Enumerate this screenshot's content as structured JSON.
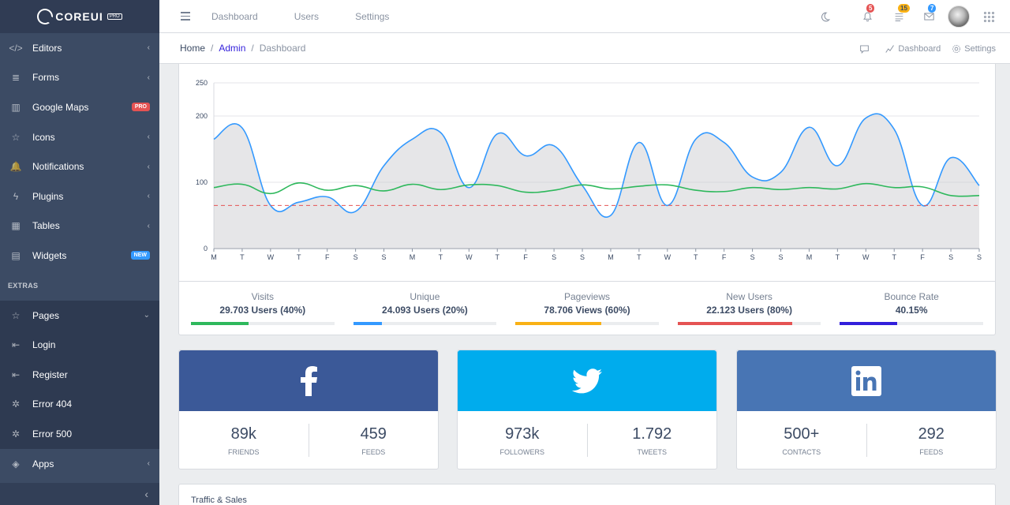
{
  "sidebar": {
    "brand": {
      "name": "COREUI",
      "tag": "PRO"
    },
    "items": [
      {
        "label": "Editors",
        "icon": "code-icon",
        "glyph": "</>",
        "chevron": "‹"
      },
      {
        "label": "Forms",
        "icon": "notes-icon",
        "glyph": "≣",
        "chevron": "‹"
      },
      {
        "label": "Google Maps",
        "icon": "map-icon",
        "glyph": "▥",
        "badge": "PRO",
        "badge_color": "#e55353"
      },
      {
        "label": "Icons",
        "icon": "star-icon",
        "glyph": "☆",
        "chevron": "‹"
      },
      {
        "label": "Notifications",
        "icon": "bell-icon",
        "glyph": "🔔",
        "chevron": "‹"
      },
      {
        "label": "Plugins",
        "icon": "bolt-icon",
        "glyph": "ϟ",
        "chevron": "‹"
      },
      {
        "label": "Tables",
        "icon": "table-icon",
        "glyph": "▦",
        "chevron": "‹"
      },
      {
        "label": "Widgets",
        "icon": "calculator-icon",
        "glyph": "▤",
        "badge": "NEW",
        "badge_color": "#3399ff"
      }
    ],
    "extras_title": "EXTRAS",
    "extras": [
      {
        "label": "Pages",
        "icon": "star-icon",
        "glyph": "☆",
        "chevron": "⌄"
      },
      {
        "label": "Login",
        "icon": "account-login-icon",
        "glyph": "⇤"
      },
      {
        "label": "Register",
        "icon": "account-logout-icon",
        "glyph": "⇤"
      },
      {
        "label": "Error 404",
        "icon": "bug-icon",
        "glyph": "✲"
      },
      {
        "label": "Error 500",
        "icon": "bug-icon",
        "glyph": "✲"
      },
      {
        "label": "Apps",
        "icon": "layers-icon",
        "glyph": "◈",
        "chevron": "‹"
      }
    ],
    "minimize_glyph": "‹"
  },
  "header": {
    "nav": [
      "Dashboard",
      "Users",
      "Settings"
    ],
    "notifications": {
      "count": "5",
      "color": "#e55353"
    },
    "tasks": {
      "count": "15",
      "color": "#f9b115"
    },
    "messages": {
      "count": "7",
      "color": "#3399ff"
    }
  },
  "breadcrumb": {
    "home": "Home",
    "admin": "Admin",
    "current": "Dashboard",
    "sep": "/"
  },
  "subheader_actions": {
    "dashboard": "Dashboard",
    "settings": "Settings"
  },
  "chart_data": {
    "type": "line",
    "x": [
      "M",
      "T",
      "W",
      "T",
      "F",
      "S",
      "S",
      "M",
      "T",
      "W",
      "T",
      "F",
      "S",
      "S",
      "M",
      "T",
      "W",
      "T",
      "F",
      "S",
      "S",
      "M",
      "T",
      "W",
      "T",
      "F",
      "S",
      "S"
    ],
    "ylim": [
      0,
      250
    ],
    "yticks": [
      "0",
      "100",
      "200",
      "250"
    ],
    "series": [
      {
        "values": [
          165,
          182,
          65,
          70,
          78,
          56,
          125,
          165,
          175,
          92,
          173,
          140,
          155,
          95,
          50,
          160,
          65,
          165,
          160,
          108,
          115,
          183,
          125,
          197,
          180,
          65,
          137,
          95
        ],
        "color": "#39f",
        "fill": "rgba(200,200,205,0.45)"
      },
      {
        "values": [
          92,
          97,
          83,
          99,
          88,
          95,
          87,
          97,
          89,
          96,
          95,
          85,
          88,
          96,
          90,
          94,
          96,
          88,
          86,
          92,
          89,
          92,
          90,
          98,
          92,
          93,
          80,
          80
        ],
        "color": "#2eb85c"
      },
      {
        "values": [
          65,
          65,
          65,
          65,
          65,
          65,
          65,
          65,
          65,
          65,
          65,
          65,
          65,
          65,
          65,
          65,
          65,
          65,
          65,
          65,
          65,
          65,
          65,
          65,
          65,
          65,
          65,
          65
        ],
        "color": "#e55353",
        "dashed": true
      }
    ]
  },
  "metrics": [
    {
      "label": "Visits",
      "value": "29.703 Users (40%)",
      "percent": 40,
      "color": "#2eb85c"
    },
    {
      "label": "Unique",
      "value": "24.093 Users (20%)",
      "percent": 20,
      "color": "#39f"
    },
    {
      "label": "Pageviews",
      "value": "78.706 Views (60%)",
      "percent": 60,
      "color": "#f9b115"
    },
    {
      "label": "New Users",
      "value": "22.123 Users (80%)",
      "percent": 80,
      "color": "#e55353"
    },
    {
      "label": "Bounce Rate",
      "value": "40.15%",
      "percent": 40.15,
      "color": "#321fdb"
    }
  ],
  "social": [
    {
      "network": "facebook",
      "glyph": "f",
      "color": "#3b5998",
      "left_value": "89k",
      "left_label": "friends",
      "right_value": "459",
      "right_label": "feeds"
    },
    {
      "network": "twitter",
      "glyph": "🐦",
      "color": "#00aced",
      "left_value": "973k",
      "left_label": "followers",
      "right_value": "1.792",
      "right_label": "tweets"
    },
    {
      "network": "linkedin",
      "glyph": "in",
      "color": "#4875b4",
      "left_value": "500+",
      "left_label": "contacts",
      "right_value": "292",
      "right_label": "feeds"
    }
  ],
  "traffic": {
    "title": "Traffic & Sales"
  }
}
